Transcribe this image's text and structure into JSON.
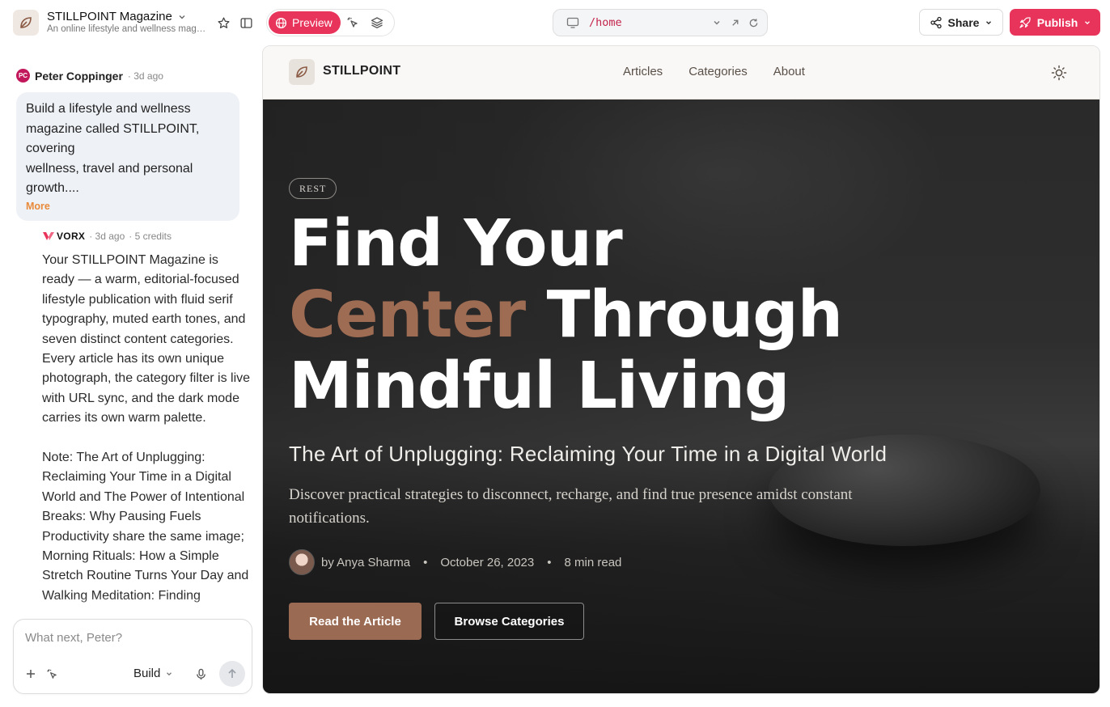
{
  "project": {
    "name": "STILLPOINT Magazine",
    "description": "An online lifestyle and wellness magazine"
  },
  "toolbar": {
    "preview_label": "Preview",
    "url_path": "/home",
    "share_label": "Share",
    "publish_label": "Publish"
  },
  "chat": {
    "user": {
      "initials": "PC",
      "name": "Peter Coppinger",
      "time": "· 3d ago",
      "message": "Build a lifestyle and wellness magazine called STILLPOINT, covering\nwellness, travel and personal growth....",
      "more_label": "More"
    },
    "assistant": {
      "brand": "VORX",
      "time": "· 3d ago",
      "credits": "· 5 credits",
      "paragraph1": "Your STILLPOINT Magazine is ready — a warm, editorial-focused lifestyle publication with fluid serif typography, muted earth tones, and seven distinct content categories. Every article has its own unique photograph, the category filter is live with URL sync, and the dark mode carries its own warm palette.",
      "paragraph2": "Note: The Art of Unplugging: Reclaiming Your Time in a Digital World and The Power of Intentional Breaks: Why Pausing Fuels Productivity share the same image; Morning Rituals: How a Simple Stretch Routine Turns Your Day and Walking Meditation: Finding"
    },
    "composer": {
      "placeholder": "What next, Peter?",
      "mode_label": "Build"
    }
  },
  "site": {
    "brand": "STILLPOINT",
    "nav": [
      "Articles",
      "Categories",
      "About"
    ],
    "hero": {
      "tag": "REST",
      "title_line1": "Find Your",
      "title_accent": "Center",
      "title_line2_rest": " Through",
      "title_line3": "Mindful Living",
      "subtitle": "The Art of Unplugging: Reclaiming Your Time in a Digital World",
      "description": "Discover practical strategies to disconnect, recharge, and find true presence amidst constant notifications.",
      "author": "by Anya Sharma",
      "date": "October 26, 2023",
      "read_time": "8 min read",
      "primary_cta": "Read the Article",
      "secondary_cta": "Browse Categories"
    }
  },
  "colors": {
    "brand_pink": "#e8335a",
    "accent_brown": "#9e6b53"
  }
}
